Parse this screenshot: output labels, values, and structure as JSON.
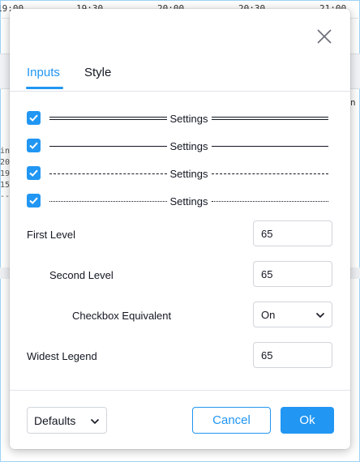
{
  "background": {
    "time_labels": [
      "19:00",
      "19:30",
      "20:00",
      "20:30",
      "21:00"
    ],
    "left_fragments": [
      "int",
      "20",
      "19",
      "15",
      "--"
    ],
    "right_fragment": "n"
  },
  "dialog": {
    "tabs": [
      {
        "label": "Inputs",
        "active": true
      },
      {
        "label": "Style",
        "active": false
      }
    ],
    "settings_rows": [
      {
        "label": "Settings",
        "checked": true,
        "line_style": "double"
      },
      {
        "label": "Settings",
        "checked": true,
        "line_style": "solid"
      },
      {
        "label": "Settings",
        "checked": true,
        "line_style": "dashed"
      },
      {
        "label": "Settings",
        "checked": true,
        "line_style": "dotted"
      }
    ],
    "fields": {
      "first_level": {
        "label": "First Level",
        "value": "65"
      },
      "second_level": {
        "label": "Second Level",
        "value": "65"
      },
      "checkbox_equivalent": {
        "label": "Checkbox Equivalent",
        "value": "On"
      },
      "widest_legend": {
        "label": "Widest Legend",
        "value": "65"
      }
    },
    "footer": {
      "defaults_label": "Defaults",
      "cancel_label": "Cancel",
      "ok_label": "Ok"
    }
  },
  "icons": {
    "close": "close-icon",
    "check": "check-icon",
    "dropdown": "chevron-down-icon"
  },
  "colors": {
    "accent": "#2196f3",
    "text": "#131722",
    "border": "#d1d4dc",
    "divider": "#e0e3eb"
  }
}
